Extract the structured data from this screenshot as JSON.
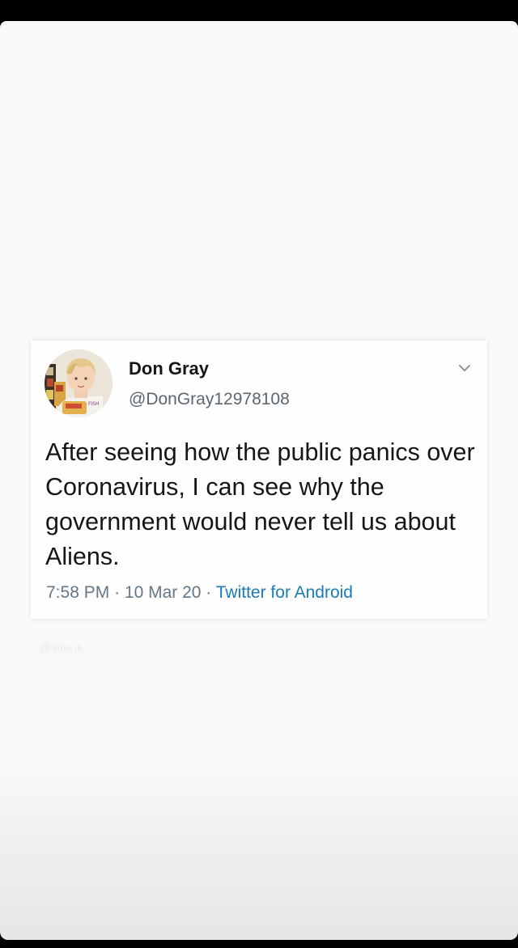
{
  "tweet": {
    "display_name": "Don Gray",
    "handle": "@DonGray12978108",
    "text": "After seeing how the public panics over Coronavirus, I can see why the government would never tell us about Aliens.",
    "time": "7:58 PM",
    "date": "10 Mar 20",
    "source": "Twitter for Android",
    "avatar_icon": "profile-photo",
    "menu_icon": "chevron-down-icon"
  },
  "watermark": "@bitc.h",
  "colors": {
    "text": "#14171a",
    "secondary": "#657786",
    "link": "#1b7ab8",
    "background": "#fbfafb"
  }
}
